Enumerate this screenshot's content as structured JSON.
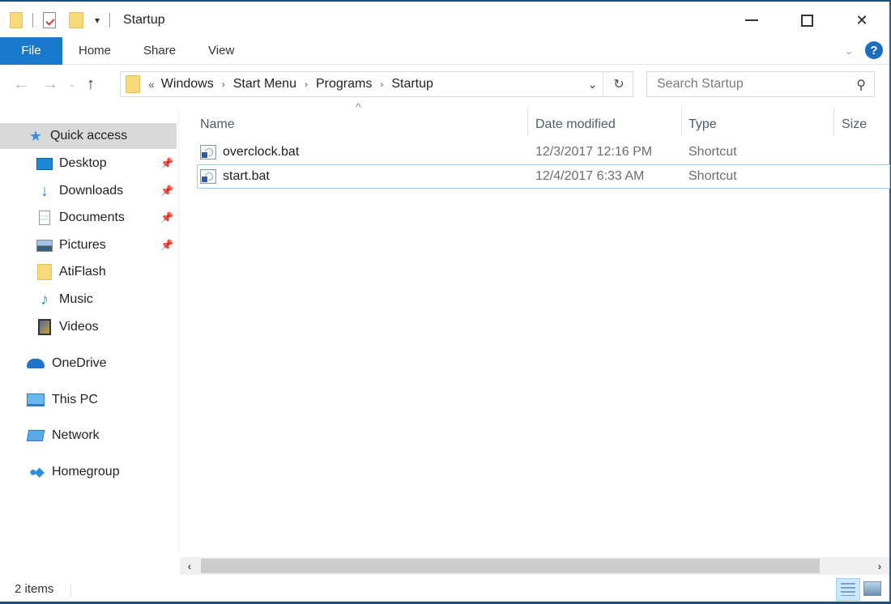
{
  "window": {
    "title": "Startup",
    "controls": {
      "minimize": "minimize",
      "maximize": "maximize",
      "close": "✕"
    }
  },
  "quick_access_toolbar": {
    "icons": [
      "folder-icon",
      "properties-icon",
      "new-folder-icon",
      "customize-dropdown-icon"
    ],
    "dropdown_glyph": "▾"
  },
  "ribbon": {
    "tabs": [
      {
        "label": "File",
        "active": true
      },
      {
        "label": "Home"
      },
      {
        "label": "Share"
      },
      {
        "label": "View"
      }
    ],
    "expand_glyph": "⌄",
    "help_glyph": "?"
  },
  "navigation": {
    "back_glyph": "←",
    "forward_glyph": "→",
    "recent_glyph": "⌄",
    "up_glyph": "↑",
    "breadcrumb_overflow": "«",
    "breadcrumb": [
      "Windows",
      "Start Menu",
      "Programs",
      "Startup"
    ],
    "breadcrumb_separator": "›",
    "address_dropdown_glyph": "⌄",
    "refresh_glyph": "↻",
    "search_placeholder": "Search Startup",
    "search_glyph": "⚲"
  },
  "sidebar": {
    "items": [
      {
        "label": "Quick access",
        "icon": "star-icon",
        "active": true
      },
      {
        "label": "Desktop",
        "icon": "desktop-icon",
        "pinned": true
      },
      {
        "label": "Downloads",
        "icon": "downloads-icon",
        "pinned": true
      },
      {
        "label": "Documents",
        "icon": "documents-icon",
        "pinned": true
      },
      {
        "label": "Pictures",
        "icon": "pictures-icon",
        "pinned": true
      },
      {
        "label": "AtiFlash",
        "icon": "folder-icon"
      },
      {
        "label": "Music",
        "icon": "music-icon"
      },
      {
        "label": "Videos",
        "icon": "videos-icon"
      },
      {
        "label": "OneDrive",
        "icon": "onedrive-icon"
      },
      {
        "label": "This PC",
        "icon": "this-pc-icon"
      },
      {
        "label": "Network",
        "icon": "network-icon"
      },
      {
        "label": "Homegroup",
        "icon": "homegroup-icon"
      }
    ],
    "pin_glyph": "📌"
  },
  "file_list": {
    "sort_indicator": "^",
    "columns": [
      "Name",
      "Date modified",
      "Type",
      "Size"
    ],
    "rows": [
      {
        "name": "overclock.bat",
        "date_modified": "12/3/2017 12:16 PM",
        "type": "Shortcut",
        "size": "",
        "selected": false
      },
      {
        "name": "start.bat",
        "date_modified": "12/4/2017 6:33 AM",
        "type": "Shortcut",
        "size": "",
        "selected": true
      }
    ]
  },
  "scrollbar": {
    "left_glyph": "‹",
    "right_glyph": "›"
  },
  "status_bar": {
    "item_count": "2 items",
    "views": [
      {
        "name": "details",
        "active": true
      },
      {
        "name": "large-icons",
        "active": false
      }
    ]
  },
  "colors": {
    "accent": "#1979ca",
    "selection_border": "#99c9ef",
    "sidebar_active": "#d9d9d9",
    "folder": "#f7d97a"
  }
}
